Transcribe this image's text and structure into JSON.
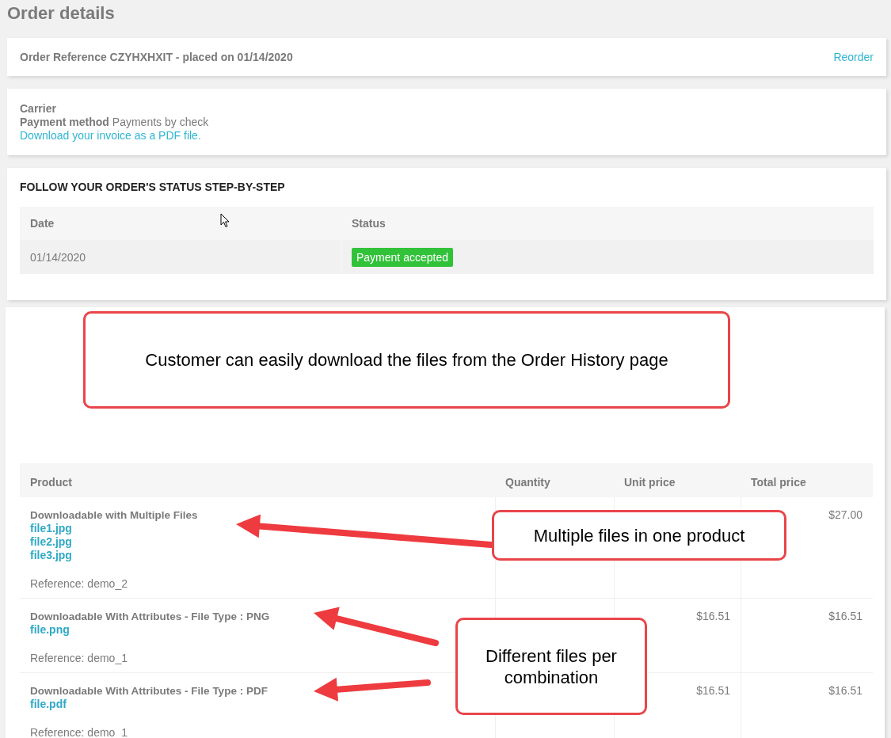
{
  "page_title": "Order details",
  "order_header": {
    "text": "Order Reference CZYHXHXIT - placed on 01/14/2020",
    "reorder_link": "Reorder"
  },
  "order_info": {
    "carrier_label": "Carrier",
    "payment_label": "Payment method",
    "payment_value": "Payments by check",
    "invoice_link": "Download your invoice as a PDF file."
  },
  "status_history": {
    "title": "FOLLOW YOUR ORDER'S STATUS STEP-BY-STEP",
    "columns": [
      "Date",
      "Status"
    ],
    "rows": [
      {
        "date": "01/14/2020",
        "status": "Payment accepted",
        "color": "#32c23a"
      }
    ]
  },
  "products": {
    "columns": [
      "Product",
      "Quantity",
      "Unit price",
      "Total price"
    ],
    "rows": [
      {
        "name": "Downloadable with Multiple Files",
        "files": [
          "file1.jpg",
          "file2.jpg",
          "file3.jpg"
        ],
        "reference": "Reference: demo_2",
        "total_price": "$27.00"
      },
      {
        "name": "Downloadable With Attributes - File Type : PNG",
        "files": [
          "file.png"
        ],
        "reference": "Reference: demo_1",
        "unit_price": "$16.51",
        "total_price": "$16.51"
      },
      {
        "name": "Downloadable With Attributes - File Type : PDF",
        "files": [
          "file.pdf"
        ],
        "reference": "Reference: demo_1",
        "unit_price": "$16.51",
        "total_price": "$16.51"
      }
    ]
  },
  "annotations": [
    {
      "text": "Customer can easily download the files from the Order History page"
    },
    {
      "text": "Multiple files in one product"
    },
    {
      "text": "Different files per combination"
    }
  ]
}
